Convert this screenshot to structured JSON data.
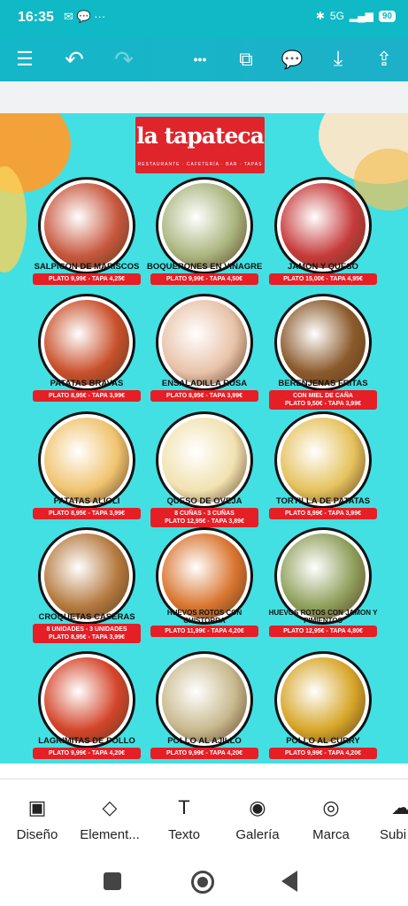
{
  "status": {
    "time": "16:35",
    "network": "5G",
    "battery": "90"
  },
  "toolbar": {
    "menu_icon": "☰",
    "undo_icon": "↶",
    "redo_icon": "↷",
    "more_icon": "•••",
    "duplicate_icon": "⧉",
    "comment_icon": "💬",
    "download_icon": "⤓",
    "share_icon": "⇪"
  },
  "logo": {
    "name": "la tapateca",
    "subtitle": "RESTAURANTE · CAFETERÍA · BAR · TAPAS"
  },
  "items": [
    {
      "name": "SALPICON DE MARISCOS",
      "lines": [
        "PLATO 9,99€ - TAPA 4,25€"
      ],
      "color": "#c7573d"
    },
    {
      "name": "BOQUERONES EN VINAGRE",
      "lines": [
        "PLATO 9,99€ - TAPA 4,50€"
      ],
      "color": "#a9b57e"
    },
    {
      "name": "JAMON Y QUESO",
      "lines": [
        "PLATO 15,00€ - TAPA 4,95€"
      ],
      "color": "#c73a3a"
    },
    {
      "name": "PATATAS BRAVAS",
      "lines": [
        "PLATO 8,95€ - TAPA 3,99€"
      ],
      "color": "#c9502b"
    },
    {
      "name": "ENSALADILLA RUSA",
      "lines": [
        "PLATO 8,95€ - TAPA 3,99€"
      ],
      "color": "#e8c2a8"
    },
    {
      "name": "BERENJENAS FRITAS",
      "lines": [
        "CON MIEL DE CAÑA",
        "PLATO 9,50€ - TAPA 3,99€"
      ],
      "color": "#8a5a2b"
    },
    {
      "name": "PATATAS ALIOLI",
      "lines": [
        "PLATO 8,95€ - TAPA 3,99€"
      ],
      "color": "#f0c36e"
    },
    {
      "name": "QUESO DE OVEJA",
      "lines": [
        "8 CUÑAS - 3 CUÑAS",
        "PLATO 12,95€ - TAPA 3,89€"
      ],
      "color": "#f1e2b0"
    },
    {
      "name": "TORTILLA DE PATATAS",
      "lines": [
        "PLATO 8,99€ - TAPA 3,99€"
      ],
      "color": "#e5c25c"
    },
    {
      "name": "CROQUETAS CASERAS",
      "lines": [
        "8 UNIDADES - 3 UNIDADES",
        "PLATO 8,95€ - TAPA 3,99€"
      ],
      "color": "#b57a3f"
    },
    {
      "name": "HUEVOS ROTOS CON CHISTORRA",
      "lines": [
        "PLATO 11,99€ - TAPA 4,20€"
      ],
      "color": "#d9752f"
    },
    {
      "name": "HUEVOS ROTOS CON JAMON Y PIMIENTOS",
      "lines": [
        "PLATO 12,95€ - TAPA 4,80€"
      ],
      "color": "#8fa05c"
    },
    {
      "name": "LAGRIMITAS DE POLLO",
      "lines": [
        "PLATO 9,99€ - TAPA 4,20€"
      ],
      "color": "#d4452a"
    },
    {
      "name": "POLLO AL AJILLO",
      "lines": [
        "PLATO 9,99€ - TAPA 4,20€"
      ],
      "color": "#c8b98d"
    },
    {
      "name": "POLLO AL CURRY",
      "lines": [
        "PLATO 9,99€ - TAPA 4,20€"
      ],
      "color": "#d7a628"
    }
  ],
  "bottom_tools": [
    {
      "label": "Diseño",
      "icon": "▣"
    },
    {
      "label": "Element...",
      "icon": "◇"
    },
    {
      "label": "Texto",
      "icon": "T"
    },
    {
      "label": "Galería",
      "icon": "◉"
    },
    {
      "label": "Marca",
      "icon": "◎"
    },
    {
      "label": "Subi",
      "icon": "☁"
    }
  ],
  "colors": {
    "accent": "#0fb9c6",
    "canvas": "#42e0e3",
    "price_red": "#e61e25"
  }
}
